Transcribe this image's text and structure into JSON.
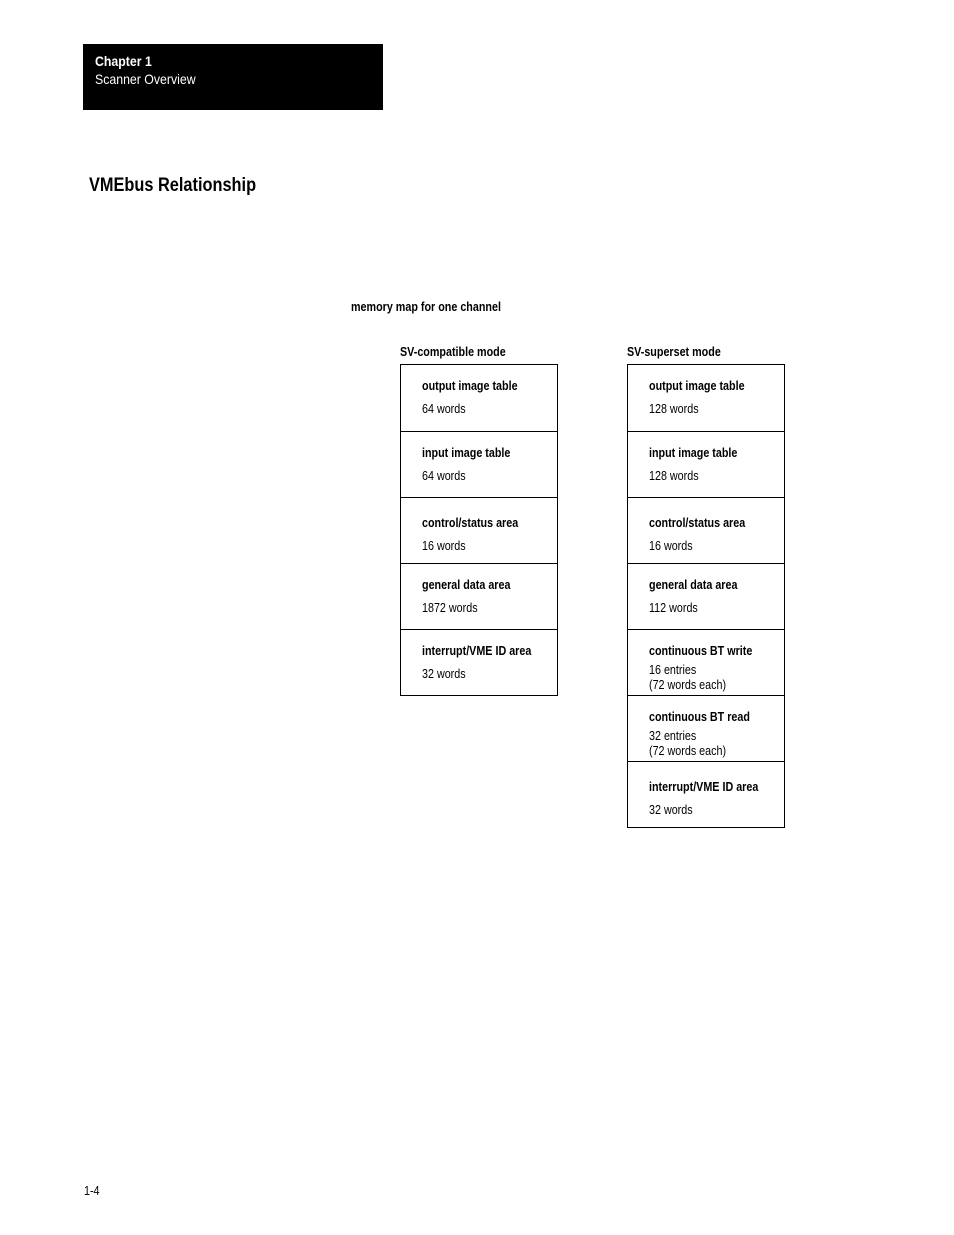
{
  "header": {
    "chapter": "Chapter 1",
    "chapter_title": "Scanner Overview"
  },
  "section_title": "VMEbus Relationship",
  "figure": {
    "title": "memory map for one channel",
    "columns": [
      {
        "label": "SV-compatible mode",
        "blocks": [
          {
            "name": "output image table",
            "size": "64 words"
          },
          {
            "name": "input image table",
            "size": "64 words"
          },
          {
            "name": "control/status area",
            "size": "16 words"
          },
          {
            "name": "general data area",
            "size": "1872 words"
          },
          {
            "name": "interrupt/VME ID area",
            "size": "32 words"
          }
        ]
      },
      {
        "label": "SV-superset mode",
        "blocks": [
          {
            "name": "output image table",
            "size": "128 words"
          },
          {
            "name": "input image table",
            "size": "128 words"
          },
          {
            "name": "control/status area",
            "size": "16 words"
          },
          {
            "name": "general data area",
            "size": "112 words"
          },
          {
            "name": "continuous BT write",
            "size": "16 entries",
            "size_note": "(72 words each)"
          },
          {
            "name": "continuous BT read",
            "size": "32 entries",
            "size_note": "(72 words each)"
          },
          {
            "name": "interrupt/VME ID area",
            "size": "32 words"
          }
        ]
      }
    ]
  },
  "footer": {
    "page_number": "1-4"
  }
}
